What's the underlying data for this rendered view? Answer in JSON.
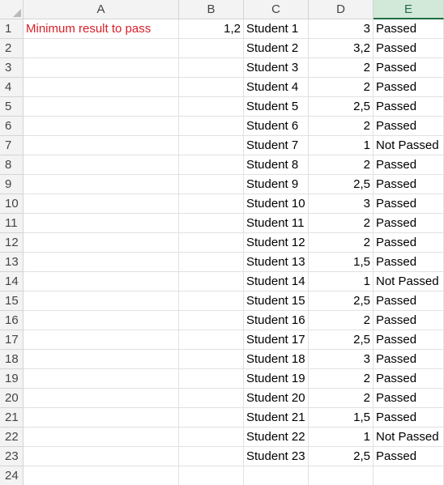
{
  "columns": [
    "A",
    "B",
    "C",
    "D",
    "E"
  ],
  "selected_column": "E",
  "rows": [
    {
      "n": "1",
      "a": "Minimum result to pass",
      "b": "1,2",
      "c": "Student 1",
      "d": "3",
      "e": "Passed"
    },
    {
      "n": "2",
      "a": "",
      "b": "",
      "c": "Student 2",
      "d": "3,2",
      "e": "Passed"
    },
    {
      "n": "3",
      "a": "",
      "b": "",
      "c": "Student 3",
      "d": "2",
      "e": "Passed"
    },
    {
      "n": "4",
      "a": "",
      "b": "",
      "c": "Student 4",
      "d": "2",
      "e": "Passed"
    },
    {
      "n": "5",
      "a": "",
      "b": "",
      "c": "Student 5",
      "d": "2,5",
      "e": "Passed"
    },
    {
      "n": "6",
      "a": "",
      "b": "",
      "c": "Student 6",
      "d": "2",
      "e": "Passed"
    },
    {
      "n": "7",
      "a": "",
      "b": "",
      "c": "Student 7",
      "d": "1",
      "e": "Not Passed"
    },
    {
      "n": "8",
      "a": "",
      "b": "",
      "c": "Student 8",
      "d": "2",
      "e": "Passed"
    },
    {
      "n": "9",
      "a": "",
      "b": "",
      "c": "Student 9",
      "d": "2,5",
      "e": "Passed"
    },
    {
      "n": "10",
      "a": "",
      "b": "",
      "c": "Student 10",
      "d": "3",
      "e": "Passed"
    },
    {
      "n": "11",
      "a": "",
      "b": "",
      "c": "Student 11",
      "d": "2",
      "e": "Passed"
    },
    {
      "n": "12",
      "a": "",
      "b": "",
      "c": "Student 12",
      "d": "2",
      "e": "Passed"
    },
    {
      "n": "13",
      "a": "",
      "b": "",
      "c": "Student 13",
      "d": "1,5",
      "e": "Passed"
    },
    {
      "n": "14",
      "a": "",
      "b": "",
      "c": "Student 14",
      "d": "1",
      "e": "Not Passed"
    },
    {
      "n": "15",
      "a": "",
      "b": "",
      "c": "Student 15",
      "d": "2,5",
      "e": "Passed"
    },
    {
      "n": "16",
      "a": "",
      "b": "",
      "c": "Student 16",
      "d": "2",
      "e": "Passed"
    },
    {
      "n": "17",
      "a": "",
      "b": "",
      "c": "Student 17",
      "d": "2,5",
      "e": "Passed"
    },
    {
      "n": "18",
      "a": "",
      "b": "",
      "c": "Student 18",
      "d": "3",
      "e": "Passed"
    },
    {
      "n": "19",
      "a": "",
      "b": "",
      "c": "Student 19",
      "d": "2",
      "e": "Passed"
    },
    {
      "n": "20",
      "a": "",
      "b": "",
      "c": "Student 20",
      "d": "2",
      "e": "Passed"
    },
    {
      "n": "21",
      "a": "",
      "b": "",
      "c": "Student 21",
      "d": "1,5",
      "e": "Passed"
    },
    {
      "n": "22",
      "a": "",
      "b": "",
      "c": "Student 22",
      "d": "1",
      "e": "Not Passed"
    },
    {
      "n": "23",
      "a": "",
      "b": "",
      "c": "Student 23",
      "d": "2,5",
      "e": "Passed"
    },
    {
      "n": "24",
      "a": "",
      "b": "",
      "c": "",
      "d": "",
      "e": ""
    }
  ],
  "colors": {
    "label_red": "#d6202a",
    "header_bg": "#f3f3f3",
    "selected_header_bg": "#d2e8d8",
    "selected_header_text": "#1d6f42",
    "gridline": "#e1e1e1"
  }
}
